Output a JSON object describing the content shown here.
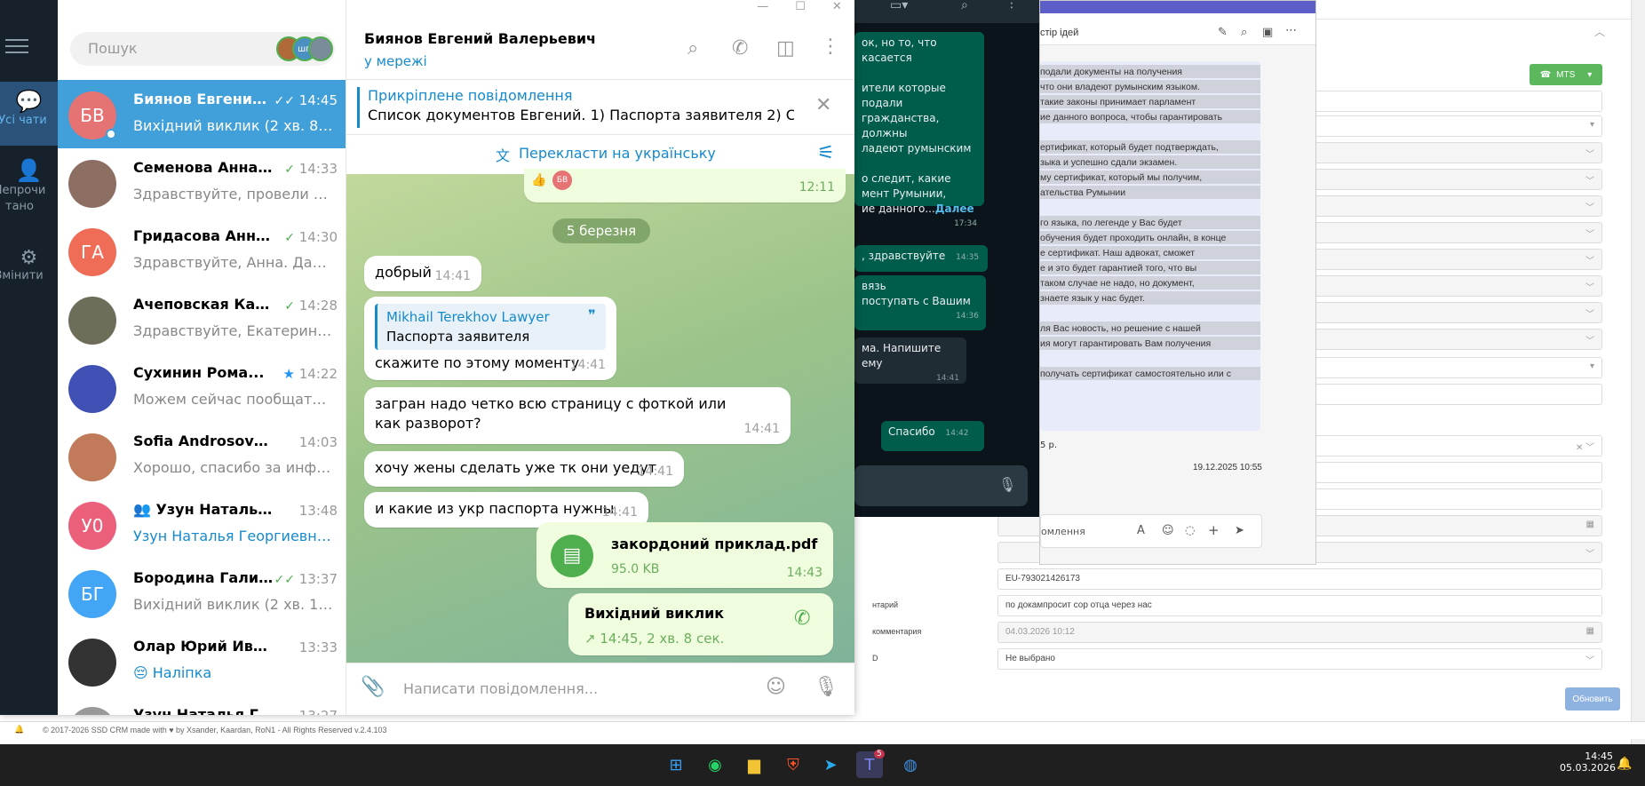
{
  "telegram": {
    "search_placeholder": "Пошук",
    "story_avatar_label": "шп",
    "rail": {
      "all_chats": "Усі чати",
      "unread": "Непрочитано",
      "edit": "Змінити"
    },
    "chats": [
      {
        "initials": "БВ",
        "name": "Биянов Евгений ...",
        "time": "14:45",
        "preview": "Вихідний виклик (2 хв. 8 сек.)",
        "color": "#e57373",
        "status": "double-check",
        "selected": true
      },
      {
        "initials": "",
        "name": "Семенова Анна В...",
        "time": "14:33",
        "preview": "Здравствуйте, провели опл...",
        "color": "#8d6e63",
        "status": "check"
      },
      {
        "initials": "ГА",
        "name": "Гридасова Анна А...",
        "time": "14:30",
        "preview": "Здравствуйте, Анна. Дайте ...",
        "color": "#ef6c57",
        "status": "check"
      },
      {
        "initials": "",
        "name": "Ачеповская Катер...",
        "time": "14:28",
        "preview": "Здравствуйте, Екатерина. Д...",
        "color": "#6d6d5a",
        "status": "check"
      },
      {
        "initials": "",
        "name": "Сухинин Рома...",
        "time": "14:22",
        "preview": "Можем сейчас пообщаться?",
        "color": "#3f51b5",
        "status": "star"
      },
      {
        "initials": "",
        "name": "Sofia Androsova 🌸",
        "time": "14:03",
        "preview": "Хорошо, спасибо за инфор...",
        "color": "#c27b5a",
        "status": ""
      },
      {
        "initials": "У0",
        "name": "Узун Наталья 09.0...",
        "time": "13:48",
        "preview": "Узун Наталья Георгиевна (В...",
        "color": "#ec5f7a",
        "status": "group",
        "preview_blue": true
      },
      {
        "initials": "БГ",
        "name": "Бородина Галина",
        "time": "13:37",
        "preview": "Вихідний виклик (2 хв. 1 сек.)",
        "color": "#42a5f5",
        "status": "double-check"
      },
      {
        "initials": "",
        "name": "Олар Юрий Иванович",
        "time": "13:33",
        "preview": "😔 Наліпка",
        "color": "#333333",
        "status": "",
        "preview_blue": true
      },
      {
        "initials": "",
        "name": "Узун Наталья Гео...",
        "time": "13:27",
        "preview": "",
        "color": "#999999",
        "status": ""
      }
    ],
    "header": {
      "name": "Биянов Евгений Валерьевич",
      "status": "у мережі"
    },
    "pinned": {
      "title": "Прикріплене повідомлення",
      "text": "Список документов Евгений.  1) Паспорта заявителя 2) Спр..."
    },
    "translate": "Перекласти на українську",
    "date_badge": "5 березня",
    "top_msg_time": "12:11",
    "messages": [
      {
        "text": "добрый",
        "time": "14:41"
      },
      {
        "reply_author": "Mikhail Terekhov Lawyer",
        "reply_text": "Паспорта заявителя",
        "text": "скажите по этому моменту",
        "time": "14:41"
      },
      {
        "text": "загран надо четко всю страницу с фоткой или как разворот?",
        "time": "14:41"
      },
      {
        "text": "хочу жены сделать уже тк они уедут",
        "time": "14:41"
      },
      {
        "text": "и какие из укр паспорта нужны",
        "time": "14:41"
      }
    ],
    "file": {
      "name": "закордоний приклад.pdf",
      "size": "95.0 KB",
      "time": "14:43"
    },
    "call": {
      "title": "Вихідний виклик",
      "detail": "14:45, 2 хв. 8 сек."
    },
    "composer_placeholder": "Написати повідомлення..."
  },
  "whatsapp": {
    "bubbles": [
      {
        "text": "ок, но то, что касается\n\nители которые подали\nгражданства, должны\nладеют румынским\n\nо следит, какие\nмент Румынии,\nие данного...",
        "more": "Далее",
        "time": "17:34"
      },
      {
        "text": ", здравствуйте",
        "time": "14:35"
      },
      {
        "text": "вязь\nпоступать с Вашим",
        "time": "14:36"
      },
      {
        "text": "ма. Напишите ему",
        "time": "14:41",
        "incoming": true
      },
      {
        "text": "Спасибо",
        "time": "14:42"
      }
    ]
  },
  "teams": {
    "title_fragment": "стір ідей",
    "lines": [
      "подали документы на получения",
      "что они владеют румынским языком.",
      "такие законы принимает парламент",
      "ие данного вопроса, чтобы гарантировать",
      "",
      "ертификат, который будет подтверждать,",
      "зыка и успешно сдали экзамен.",
      "му сертификат, который мы получим,",
      "ательства Румынии",
      "",
      "го языка, по легенде у Вас будет",
      "обучения будет проходить онлайн, в конце",
      "е сертификат. Наш адвокат, сможет",
      "е и это будет гарантией того, что вы",
      "таком случае не надо, но документ,",
      "знаете язык у нас будет.",
      "",
      "ля Вас новость, но решение с нашей",
      "ия могут гарантировать Вам получения",
      "",
      "получать сертификат самостоятельно или с"
    ],
    "price_fragment": "5 р.",
    "timestamp": "19.12.2025 10:55",
    "compose_fragment": "омлення"
  },
  "crm": {
    "mts_button": "MTS",
    "fields": [
      {
        "label": "",
        "value": "EU-793021426173"
      },
      {
        "label": "нтарий",
        "value": "по докампросит сор отца через нас"
      },
      {
        "label": "комментария",
        "value": "04.03.2026 10:12",
        "disabled": true
      },
      {
        "label": "D",
        "value": "Не выбрано"
      }
    ],
    "update_button": "Обновить",
    "footer": "© 2017-2026 SSD CRM made with ♥ by Xsander, Kaardan, RoN1 - All Rights Reserved v.2.4.103"
  },
  "taskbar": {
    "time": "14:45",
    "date": "05.03.2026",
    "teams_badge": "5"
  },
  "colors": {
    "telegram_blue": "#419fd9",
    "rail_bg": "#17212b",
    "wa_green": "#005c4b",
    "crm_green": "#5cb85c"
  }
}
